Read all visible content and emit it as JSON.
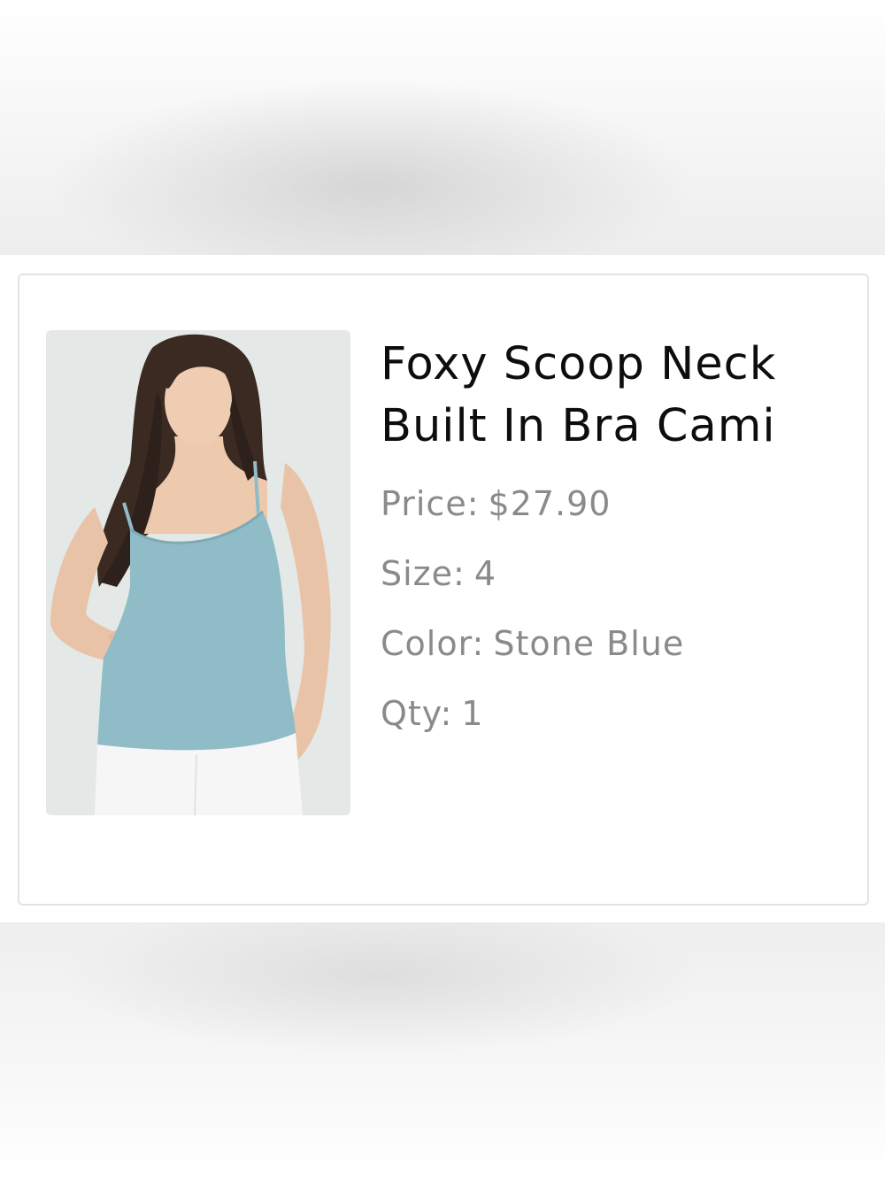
{
  "product": {
    "title": "Foxy Scoop Neck Built In Bra Cami",
    "image_alt": "Model wearing stone blue scoop neck cami with white pants",
    "details": {
      "price_label": "Price:",
      "price_value": "$27.90",
      "size_label": "Size:",
      "size_value": "4",
      "color_label": "Color:",
      "color_value": "Stone Blue",
      "qty_label": "Qty:",
      "qty_value": "1"
    }
  },
  "colors": {
    "cami": "#8fbcc6",
    "title_text": "#0d0d0d",
    "detail_text": "#8a8a8a",
    "card_border": "#e3e3e3"
  }
}
